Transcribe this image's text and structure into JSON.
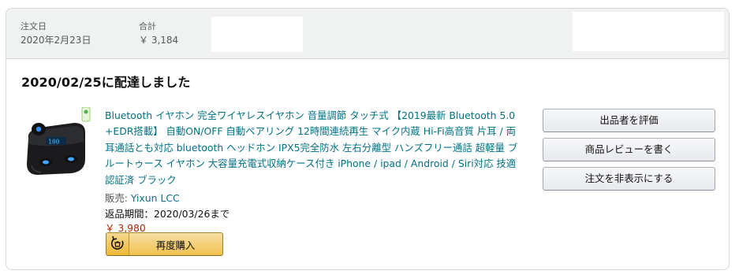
{
  "order": {
    "date_label": "注文日",
    "date_value": "2020年2月23日",
    "total_label": "合計",
    "total_value": "￥ 3,184"
  },
  "delivery": {
    "status": "2020/02/25に配達しました"
  },
  "product": {
    "title": "Bluetooth イヤホン 完全ワイヤレスイヤホン 音量調節 タッチ式 【2019最新 Bluetooth 5.0 +EDR搭載】 自動ON/OFF 自動ペアリング 12時間連続再生 マイク内蔵 Hi-Fi高音質 片耳 / 両耳通話とも対応 bluetooth ヘッドホン IPX5完全防水 左右分離型 ハンズフリー通話 超軽量 ブルートゥース イヤホン 大容量充電式収納ケース付き iPhone / ipad / Android / Siri対応 技適認証済 ブラック",
    "seller_label": "販売: ",
    "seller_name": "Yixun LCC",
    "return_period": "返品期間：2020/03/26まで",
    "price": "￥ 3,980",
    "buy_again_label": "再度購入",
    "thumbnail_icon": "earbuds-charging-case-image"
  },
  "actions": {
    "rate_seller": "出品者を評価",
    "write_review": "商品レビューを書く",
    "hide_order": "注文を非表示にする"
  },
  "colors": {
    "link": "#007185",
    "price": "#b12704",
    "header_bg": "#f0f2f2",
    "buy_button": "#f0c14b"
  }
}
